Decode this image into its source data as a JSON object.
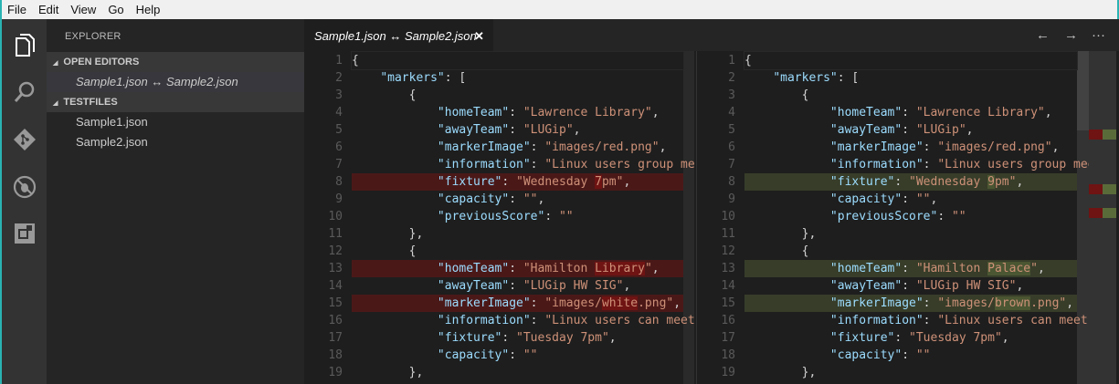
{
  "menu": [
    "File",
    "Edit",
    "View",
    "Go",
    "Help"
  ],
  "activity": [
    "files-icon",
    "search-icon",
    "git-icon",
    "debug-icon",
    "extensions-icon"
  ],
  "sidebar": {
    "title": "EXPLORER",
    "open_editors": "OPEN EDITORS",
    "open_item": "Sample1.json ↔ Sample2.json",
    "folder": "TESTFILES",
    "files": [
      "Sample1.json",
      "Sample2.json"
    ]
  },
  "tab": {
    "label": "Sample1.json ↔ Sample2.json",
    "close": "✕"
  },
  "toolbar": {
    "prev": "←",
    "next": "→",
    "more": "···"
  },
  "colors": {
    "deleted_line": "#4b1818",
    "deleted_char": "#6f1313",
    "inserted_line": "#373d29",
    "inserted_char": "#4b5632"
  },
  "left": {
    "changed": [
      8,
      13,
      15
    ],
    "lines": [
      [
        [
          "p",
          "{"
        ]
      ],
      [
        [
          "p",
          "    "
        ],
        [
          "k",
          "\"markers\""
        ],
        [
          "p",
          ": ["
        ]
      ],
      [
        [
          "p",
          "        {"
        ]
      ],
      [
        [
          "p",
          "            "
        ],
        [
          "k",
          "\"homeTeam\""
        ],
        [
          "p",
          ": "
        ],
        [
          "s",
          "\"Lawrence Library\""
        ],
        [
          "p",
          ","
        ]
      ],
      [
        [
          "p",
          "            "
        ],
        [
          "k",
          "\"awayTeam\""
        ],
        [
          "p",
          ": "
        ],
        [
          "s",
          "\"LUGip\""
        ],
        [
          "p",
          ","
        ]
      ],
      [
        [
          "p",
          "            "
        ],
        [
          "k",
          "\"markerImage\""
        ],
        [
          "p",
          ": "
        ],
        [
          "s",
          "\"images/red.png\""
        ],
        [
          "p",
          ","
        ]
      ],
      [
        [
          "p",
          "            "
        ],
        [
          "k",
          "\"information\""
        ],
        [
          "p",
          ": "
        ],
        [
          "s",
          "\"Linux users group meets second Wednesday of each month.\""
        ]
      ],
      [
        [
          "p",
          "            "
        ],
        [
          "k",
          "\"fixture\""
        ],
        [
          "p",
          ": "
        ],
        [
          "s",
          "\"Wednesday "
        ],
        [
          "sd",
          "7"
        ],
        [
          "s",
          "pm\""
        ],
        [
          "p",
          ","
        ]
      ],
      [
        [
          "p",
          "            "
        ],
        [
          "k",
          "\"capacity\""
        ],
        [
          "p",
          ": "
        ],
        [
          "s",
          "\"\""
        ],
        [
          "p",
          ","
        ]
      ],
      [
        [
          "p",
          "            "
        ],
        [
          "k",
          "\"previousScore\""
        ],
        [
          "p",
          ": "
        ],
        [
          "s",
          "\"\""
        ]
      ],
      [
        [
          "p",
          "        },"
        ]
      ],
      [
        [
          "p",
          "        {"
        ]
      ],
      [
        [
          "p",
          "            "
        ],
        [
          "k",
          "\"homeTeam\""
        ],
        [
          "p",
          ": "
        ],
        [
          "s",
          "\"Hamilton "
        ],
        [
          "sd",
          "Library"
        ],
        [
          "s",
          "\""
        ],
        [
          "p",
          ","
        ]
      ],
      [
        [
          "p",
          "            "
        ],
        [
          "k",
          "\"awayTeam\""
        ],
        [
          "p",
          ": "
        ],
        [
          "s",
          "\"LUGip HW SIG\""
        ],
        [
          "p",
          ","
        ]
      ],
      [
        [
          "p",
          "            "
        ],
        [
          "k",
          "\"markerImage\""
        ],
        [
          "p",
          ": "
        ],
        [
          "s",
          "\"images/"
        ],
        [
          "sd",
          "white"
        ],
        [
          "s",
          ".png\""
        ],
        [
          "p",
          ","
        ]
      ],
      [
        [
          "p",
          "            "
        ],
        [
          "k",
          "\"information\""
        ],
        [
          "p",
          ": "
        ],
        [
          "s",
          "\"Linux users can meet every Tuesday.\""
        ]
      ],
      [
        [
          "p",
          "            "
        ],
        [
          "k",
          "\"fixture\""
        ],
        [
          "p",
          ": "
        ],
        [
          "s",
          "\"Tuesday 7pm\""
        ],
        [
          "p",
          ","
        ]
      ],
      [
        [
          "p",
          "            "
        ],
        [
          "k",
          "\"capacity\""
        ],
        [
          "p",
          ": "
        ],
        [
          "s",
          "\"\""
        ]
      ],
      [
        [
          "p",
          "        },"
        ]
      ]
    ]
  },
  "right": {
    "changed": [
      8,
      13,
      15
    ],
    "lines": [
      [
        [
          "p",
          "{"
        ]
      ],
      [
        [
          "p",
          "    "
        ],
        [
          "k",
          "\"markers\""
        ],
        [
          "p",
          ": ["
        ]
      ],
      [
        [
          "p",
          "        {"
        ]
      ],
      [
        [
          "p",
          "            "
        ],
        [
          "k",
          "\"homeTeam\""
        ],
        [
          "p",
          ": "
        ],
        [
          "s",
          "\"Lawrence Library\""
        ],
        [
          "p",
          ","
        ]
      ],
      [
        [
          "p",
          "            "
        ],
        [
          "k",
          "\"awayTeam\""
        ],
        [
          "p",
          ": "
        ],
        [
          "s",
          "\"LUGip\""
        ],
        [
          "p",
          ","
        ]
      ],
      [
        [
          "p",
          "            "
        ],
        [
          "k",
          "\"markerImage\""
        ],
        [
          "p",
          ": "
        ],
        [
          "s",
          "\"images/red.png\""
        ],
        [
          "p",
          ","
        ]
      ],
      [
        [
          "p",
          "            "
        ],
        [
          "k",
          "\"information\""
        ],
        [
          "p",
          ": "
        ],
        [
          "s",
          "\"Linux users group meets second Wednesday of each month.\""
        ]
      ],
      [
        [
          "p",
          "            "
        ],
        [
          "k",
          "\"fixture\""
        ],
        [
          "p",
          ": "
        ],
        [
          "s",
          "\"Wednesday "
        ],
        [
          "si",
          "9"
        ],
        [
          "s",
          "pm\""
        ],
        [
          "p",
          ","
        ]
      ],
      [
        [
          "p",
          "            "
        ],
        [
          "k",
          "\"capacity\""
        ],
        [
          "p",
          ": "
        ],
        [
          "s",
          "\"\""
        ],
        [
          "p",
          ","
        ]
      ],
      [
        [
          "p",
          "            "
        ],
        [
          "k",
          "\"previousScore\""
        ],
        [
          "p",
          ": "
        ],
        [
          "s",
          "\"\""
        ]
      ],
      [
        [
          "p",
          "        },"
        ]
      ],
      [
        [
          "p",
          "        {"
        ]
      ],
      [
        [
          "p",
          "            "
        ],
        [
          "k",
          "\"homeTeam\""
        ],
        [
          "p",
          ": "
        ],
        [
          "s",
          "\"Hamilton "
        ],
        [
          "si",
          "Palace"
        ],
        [
          "s",
          "\""
        ],
        [
          "p",
          ","
        ]
      ],
      [
        [
          "p",
          "            "
        ],
        [
          "k",
          "\"awayTeam\""
        ],
        [
          "p",
          ": "
        ],
        [
          "s",
          "\"LUGip HW SIG\""
        ],
        [
          "p",
          ","
        ]
      ],
      [
        [
          "p",
          "            "
        ],
        [
          "k",
          "\"markerImage\""
        ],
        [
          "p",
          ": "
        ],
        [
          "s",
          "\"images/"
        ],
        [
          "si",
          "brown"
        ],
        [
          "s",
          ".png\""
        ],
        [
          "p",
          ","
        ]
      ],
      [
        [
          "p",
          "            "
        ],
        [
          "k",
          "\"information\""
        ],
        [
          "p",
          ": "
        ],
        [
          "s",
          "\"Linux users can meet every Tuesday.\""
        ]
      ],
      [
        [
          "p",
          "            "
        ],
        [
          "k",
          "\"fixture\""
        ],
        [
          "p",
          ": "
        ],
        [
          "s",
          "\"Tuesday 7pm\""
        ],
        [
          "p",
          ","
        ]
      ],
      [
        [
          "p",
          "            "
        ],
        [
          "k",
          "\"capacity\""
        ],
        [
          "p",
          ": "
        ],
        [
          "s",
          "\"\""
        ]
      ],
      [
        [
          "p",
          "        },"
        ]
      ]
    ]
  }
}
